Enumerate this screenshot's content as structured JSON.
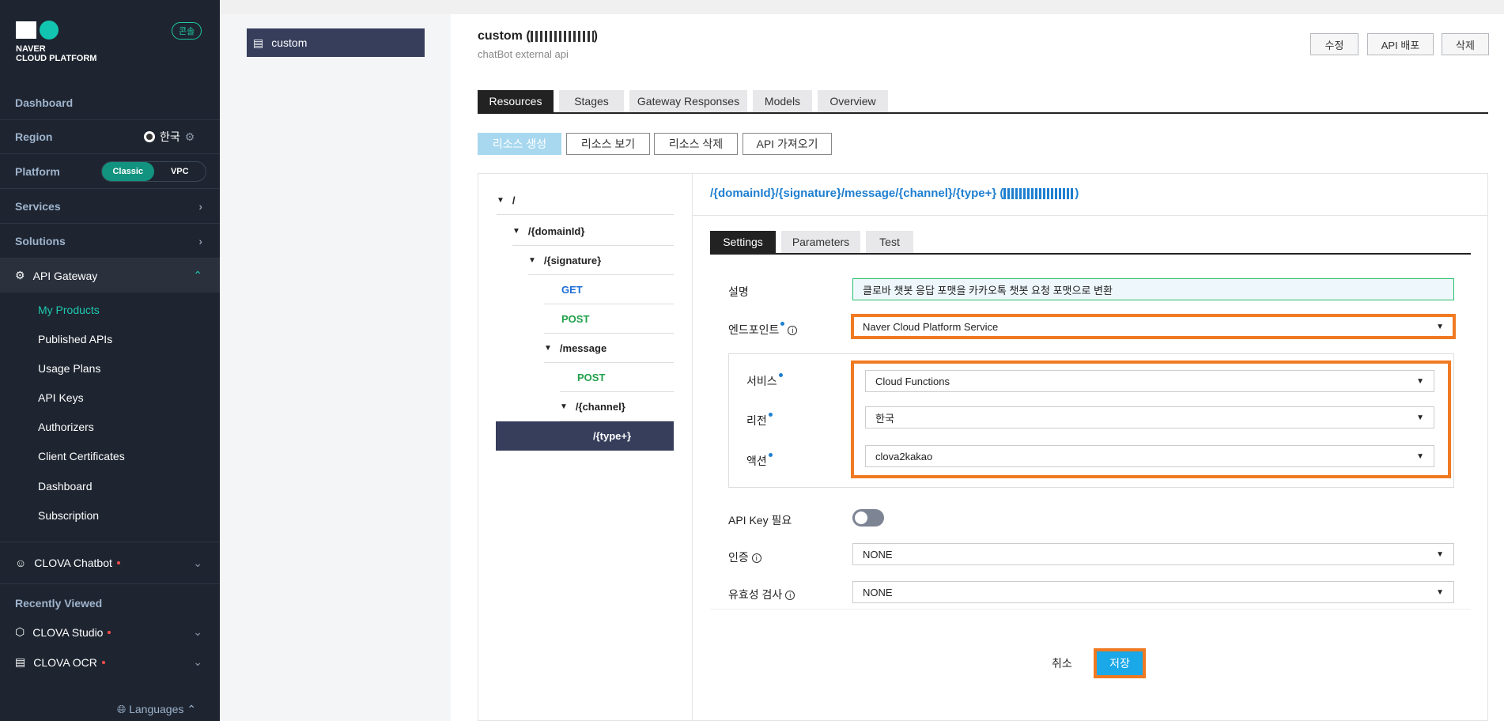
{
  "sidebar": {
    "logo_line1": "NAVER",
    "logo_line2": "CLOUD PLATFORM",
    "console_badge": "콘솔",
    "dashboard": "Dashboard",
    "region_label": "Region",
    "region_value": "한국",
    "platform_label": "Platform",
    "platform_options": [
      "Classic",
      "VPC"
    ],
    "services": "Services",
    "solutions": "Solutions",
    "api_gateway": "API Gateway",
    "api_items": [
      "My Products",
      "Published APIs",
      "Usage Plans",
      "API Keys",
      "Authorizers",
      "Client Certificates",
      "Dashboard",
      "Subscription"
    ],
    "clova_chatbot": "CLOVA Chatbot",
    "recently_viewed": "Recently Viewed",
    "recent_items": [
      "CLOVA Studio",
      "CLOVA OCR"
    ],
    "languages": "Languages"
  },
  "product_list": {
    "selected": "custom"
  },
  "header": {
    "title": "custom (",
    "subtitle": "chatBot external api",
    "buttons": [
      "수정",
      "API 배포",
      "삭제"
    ]
  },
  "tabs": [
    "Resources",
    "Stages",
    "Gateway Responses",
    "Models",
    "Overview"
  ],
  "toolbar": [
    "리소스 생성",
    "리소스 보기",
    "리소스 삭제",
    "API 가져오기"
  ],
  "tree": [
    {
      "label": "/",
      "kind": "folder"
    },
    {
      "label": "/{domainId}",
      "kind": "folder"
    },
    {
      "label": "/{signature}",
      "kind": "folder"
    },
    {
      "label": "GET",
      "kind": "get"
    },
    {
      "label": "POST",
      "kind": "post"
    },
    {
      "label": "/message",
      "kind": "folder"
    },
    {
      "label": "POST",
      "kind": "post"
    },
    {
      "label": "/{channel}",
      "kind": "folder"
    },
    {
      "label": "/{type+}",
      "kind": "selected"
    }
  ],
  "detail": {
    "path": "/{domainId}/{signature}/message/{channel}/{type+} (",
    "path_close": ")",
    "tabs": [
      "Settings",
      "Parameters",
      "Test"
    ],
    "desc_label": "설명",
    "desc_value": "클로바 챗봇 응답 포맷을 카카오톡 챗봇 요청 포맷으로 변환",
    "endpoint_label": "엔드포인트",
    "endpoint_value": "Naver Cloud Platform Service",
    "service_label": "서비스",
    "service_value": "Cloud Functions",
    "region_label": "리전",
    "region_value": "한국",
    "action_label": "액션",
    "action_value": "clova2kakao",
    "apikey_label": "API Key 필요",
    "apikey_enabled": false,
    "auth_label": "인증",
    "auth_value": "NONE",
    "validation_label": "유효성 검사",
    "validation_value": "NONE",
    "cancel": "취소",
    "save": "저장"
  },
  "colors": {
    "accent": "#1aa8e8",
    "highlight": "#f07a22",
    "sidebar_bg": "#1e2530",
    "selected_bg": "#363e5c"
  }
}
